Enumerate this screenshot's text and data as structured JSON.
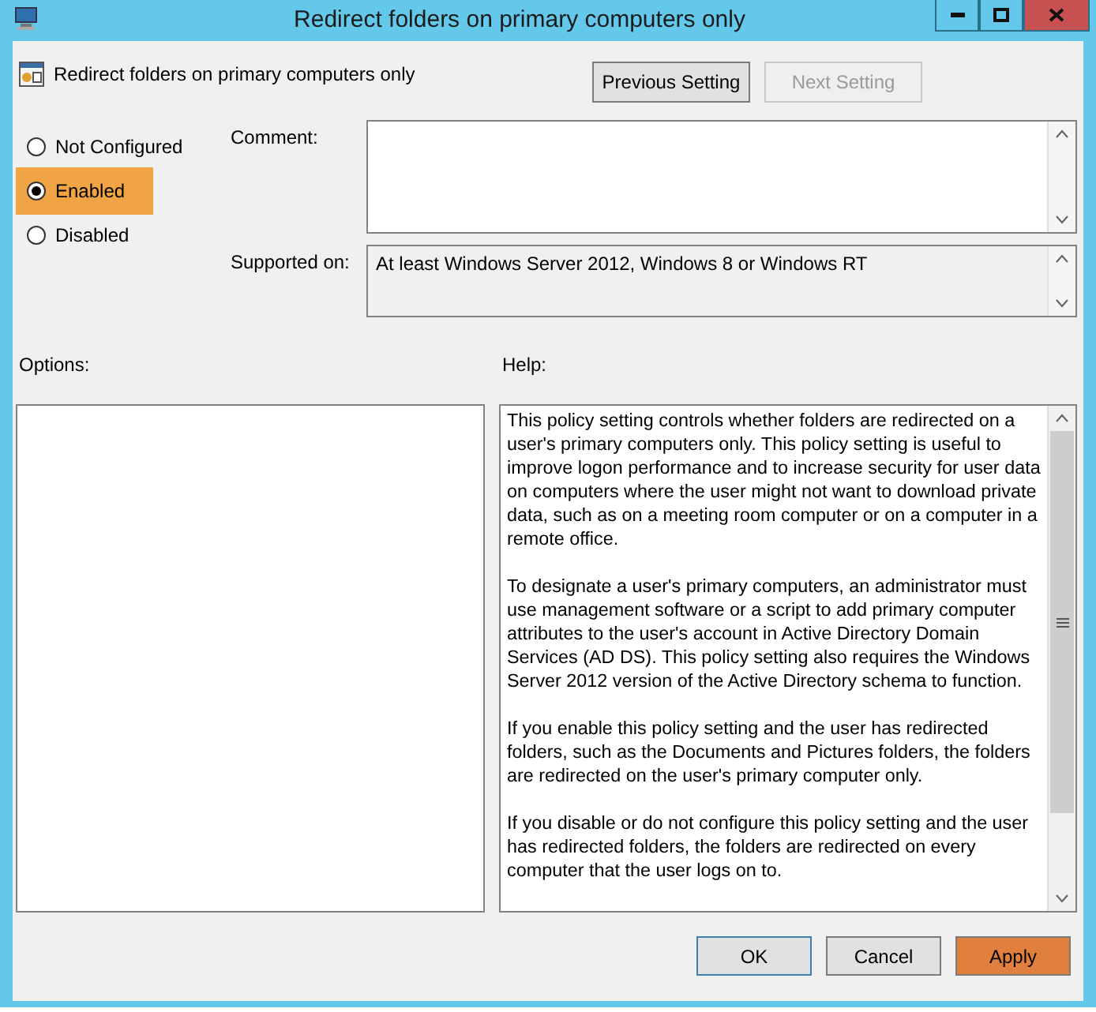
{
  "window": {
    "title": "Redirect folders on primary computers only"
  },
  "header": {
    "title": "Redirect folders on primary computers only",
    "buttons": [
      {
        "label": "Previous Setting",
        "disabled": false
      },
      {
        "label": "Next Setting",
        "disabled": true
      }
    ]
  },
  "states": [
    {
      "label": "Not Configured",
      "selected": false
    },
    {
      "label": "Enabled",
      "selected": true
    },
    {
      "label": "Disabled",
      "selected": false
    }
  ],
  "comment": {
    "label": "Comment:"
  },
  "supported": {
    "label": "Supported on:",
    "value": "At least Windows Server 2012, Windows 8 or Windows RT"
  },
  "options": {
    "label": "Options:"
  },
  "help": {
    "label": "Help:",
    "paragraphs": [
      "This policy setting controls whether folders are redirected on a user's primary computers only. This policy setting is useful to improve logon performance and to increase security for user data on computers where the user might not want to download private data, such as on a meeting room computer or on a computer in a remote office.",
      "To designate a user's primary computers, an administrator must use management software or a script to add primary computer attributes to the user's account in Active Directory Domain Services (AD DS). This policy setting also requires the Windows Server 2012 version of the Active Directory schema to function.",
      "If you enable this policy setting and the user has redirected folders, such as the Documents and Pictures folders, the folders are redirected on the user's primary computer only.",
      "If you disable or do not configure this policy setting and the user has redirected folders, the folders are redirected on every computer that the user logs on to."
    ]
  },
  "footer": {
    "buttons": [
      {
        "label": "OK",
        "kind": "default"
      },
      {
        "label": "Cancel",
        "kind": "normal"
      },
      {
        "label": "Apply",
        "kind": "accent"
      }
    ]
  }
}
